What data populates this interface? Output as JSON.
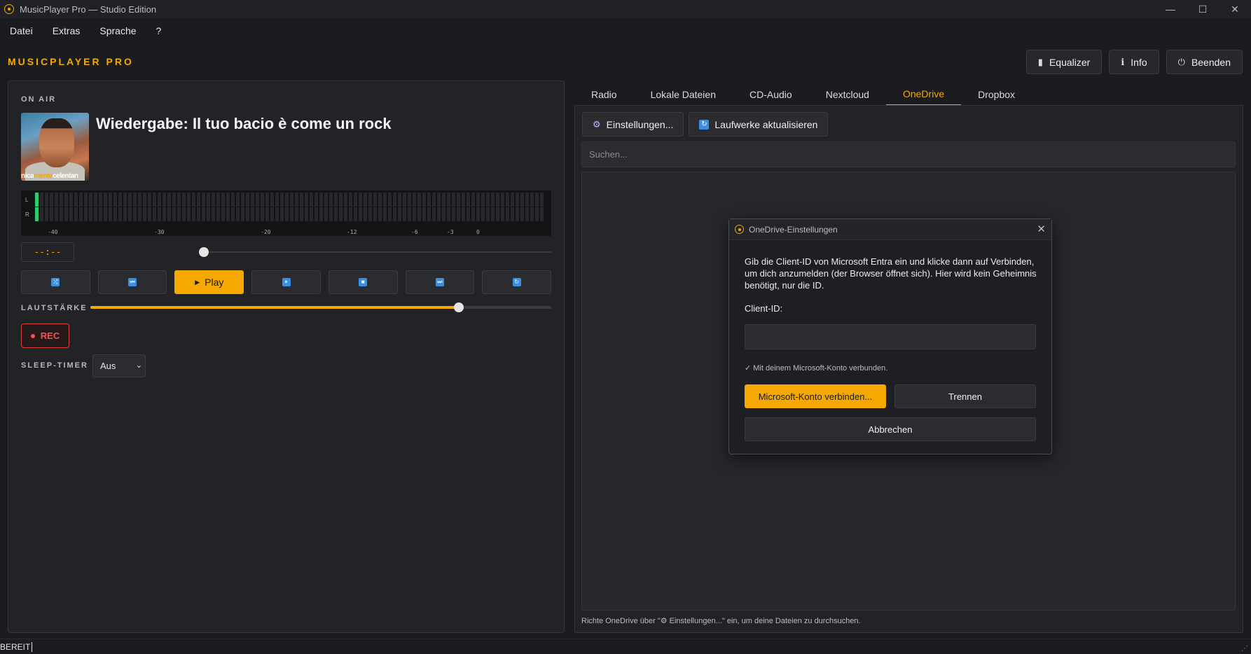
{
  "window": {
    "title": "MusicPlayer Pro — Studio Edition",
    "controls": [
      "—",
      "☐",
      "✕"
    ]
  },
  "menu": [
    "Datei",
    "Extras",
    "Sprache",
    "?"
  ],
  "brand": "MUSICPLAYER PRO",
  "header": {
    "equalizer": "Equalizer",
    "info": "Info",
    "quit": "Beenden"
  },
  "player": {
    "on_air": "ON AIR",
    "now_playing": "Wiedergabe: Il tuo bacio è come un rock",
    "cover_text_a": "nica",
    "cover_text_b": "mente",
    "cover_text_c": "celentan",
    "time": "--:--",
    "vu_channels": [
      "L",
      "R"
    ],
    "vu_scale": [
      "-40",
      "-30",
      "-20",
      "-12",
      "-6",
      "-3",
      "0"
    ],
    "play_label": "Play",
    "volume_label": "LAUTSTÄRKE",
    "volume_level": 0.8,
    "seek_position": 0.0,
    "rec_label": "REC",
    "sleep_label": "SLEEP-TIMER",
    "sleep_value": "Aus"
  },
  "tabs": [
    "Radio",
    "Lokale Dateien",
    "CD-Audio",
    "Nextcloud",
    "OneDrive",
    "Dropbox"
  ],
  "active_tab": "OneDrive",
  "onedrive": {
    "settings_button": "Einstellungen...",
    "refresh_button": "Laufwerke aktualisieren",
    "search_placeholder": "Suchen...",
    "hint": "Richte OneDrive über \"⚙ Einstellungen...\" ein, um deine Dateien zu durchsuchen."
  },
  "dialog": {
    "title": "OneDrive-Einstellungen",
    "message": "Gib die Client-ID von Microsoft Entra ein und klicke dann auf Verbinden, um dich anzumelden (der Browser öffnet sich). Hier wird kein Geheimnis benötigt, nur die ID.",
    "client_id_label": "Client-ID:",
    "client_id_value": "",
    "status": "✓ Mit deinem Microsoft-Konto verbunden.",
    "connect_button": "Microsoft-Konto verbinden...",
    "disconnect_button": "Trennen",
    "cancel_button": "Abbrechen"
  },
  "status_bar": "BEREIT",
  "colors": {
    "accent": "#f5a800",
    "vu_active": "#2ecc71",
    "rec": "#ff4d4d"
  }
}
